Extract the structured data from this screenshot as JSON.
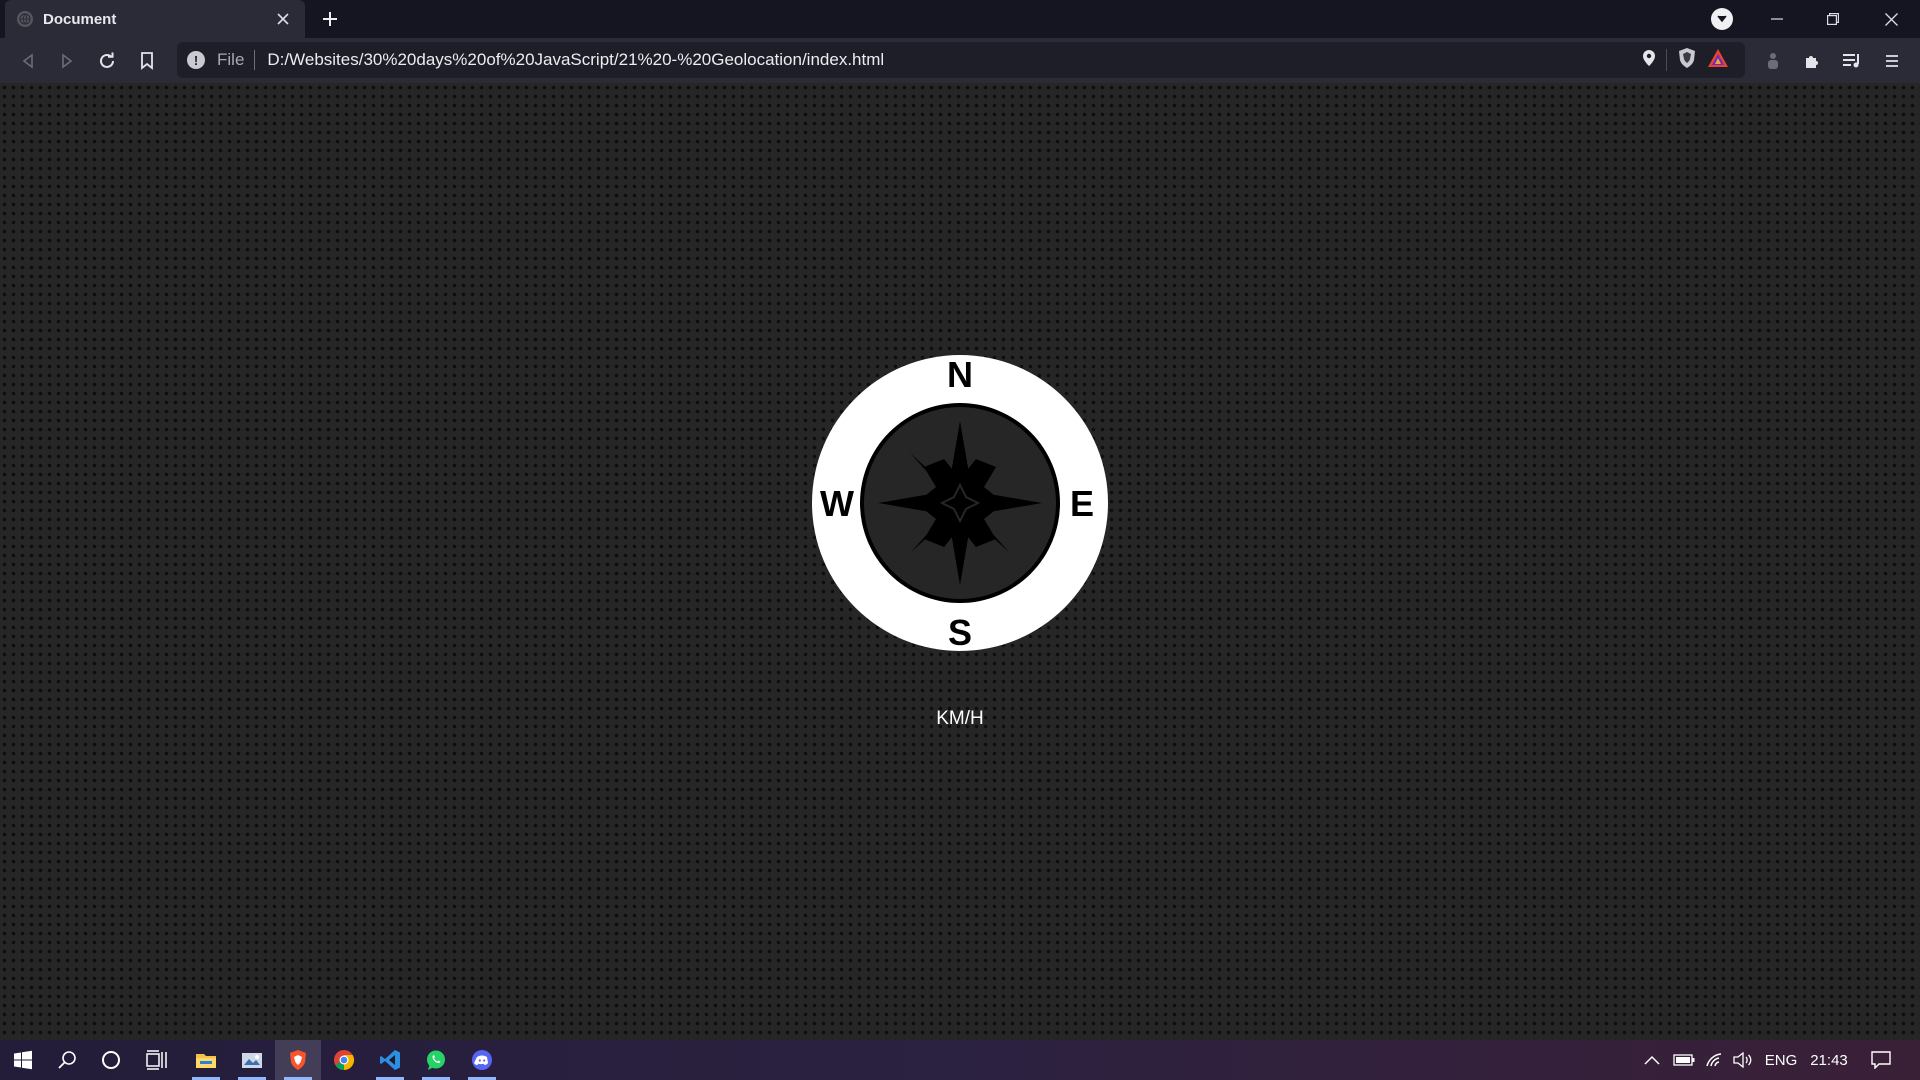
{
  "browser": {
    "tab": {
      "title": "Document"
    },
    "address_bar": {
      "scheme": "File",
      "url": "D:/Websites/30%20days%20of%20JavaScript/21%20-%20Geolocation/index.html"
    }
  },
  "page": {
    "compass": {
      "north": "N",
      "south": "S",
      "east": "E",
      "west": "W"
    },
    "speed_unit": "KM/H"
  },
  "taskbar": {
    "apps": [
      "File Explorer",
      "Photos",
      "Brave",
      "Chrome",
      "Visual Studio Code",
      "WhatsApp",
      "Discord"
    ],
    "tray": {
      "language": "ENG",
      "time": "21:43"
    }
  },
  "colors": {
    "page_background": "#262626",
    "compass": "#ffffff",
    "browser_frame": "#2a2b36"
  }
}
